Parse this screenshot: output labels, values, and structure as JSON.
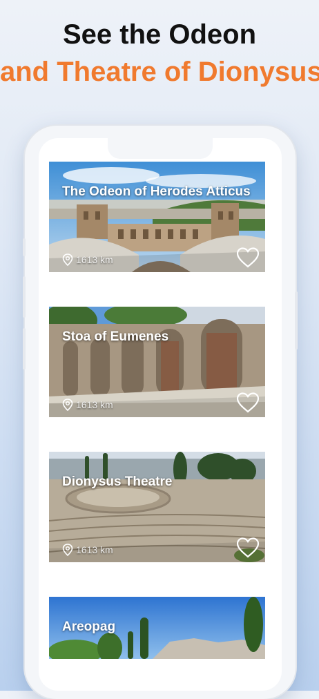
{
  "promo": {
    "line1": "See the Odeon",
    "line2": "and Theatre of Dionysus"
  },
  "cards": [
    {
      "title": "The Odeon of Herodes Atticus",
      "distance": "1613 km"
    },
    {
      "title": "Stoa of Eumenes",
      "distance": "1613 km"
    },
    {
      "title": "Dionysus Theatre",
      "distance": "1613 km"
    },
    {
      "title": "Areopag",
      "distance": ""
    }
  ],
  "icons": {
    "location": "map-pin-icon",
    "favorite": "heart-outline-icon"
  },
  "colors": {
    "headline_primary": "#111111",
    "headline_accent": "#f07a2e",
    "background_top": "#eef2f8",
    "background_bottom": "#b9d0ee"
  }
}
